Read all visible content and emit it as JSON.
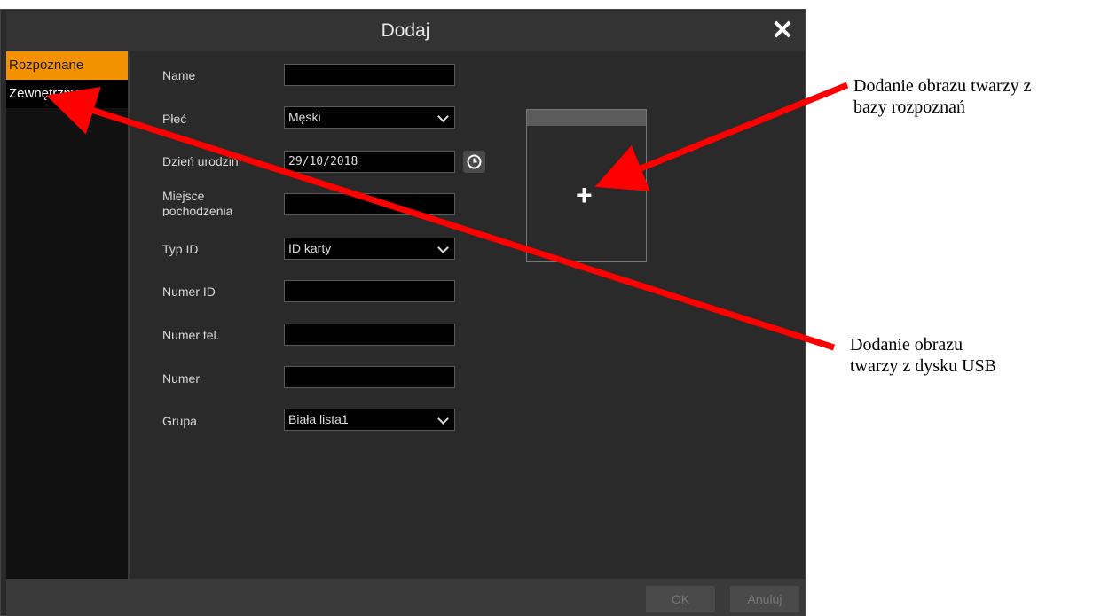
{
  "dialog": {
    "title": "Dodaj",
    "close_symbol": "✕"
  },
  "sidebar": {
    "items": [
      {
        "label": "Rozpoznane",
        "active": true
      },
      {
        "label": "Zewnętrzny",
        "active": false
      }
    ]
  },
  "form": {
    "name_label": "Name",
    "name_value": "",
    "gender_label": "Płeć",
    "gender_value": "Męski",
    "birthday_label": "Dzień urodzin",
    "birthday_value": "29/10/2018",
    "origin_label_line1": "Miejsce",
    "origin_label_line2": "pochodzenia",
    "origin_value": "",
    "id_type_label": "Typ ID",
    "id_type_value": "ID karty",
    "id_number_label": "Numer ID",
    "id_number_value": "",
    "phone_label": "Numer tel.",
    "phone_value": "",
    "number_label": "Numer",
    "number_value": "",
    "group_label": "Grupa",
    "group_value": "Biała lista1"
  },
  "photo": {
    "add_symbol": "+"
  },
  "footer": {
    "ok_label": "OK",
    "cancel_label": "Anuluj"
  },
  "annotations": {
    "top_line1": "Dodanie obrazu twarzy z",
    "top_line2": "bazy rozpoznań",
    "bottom_line1": "Dodanie obrazu",
    "bottom_line2": "twarzy z dysku USB"
  },
  "colors": {
    "accent": "#f39200",
    "arrow": "#ff0000"
  }
}
